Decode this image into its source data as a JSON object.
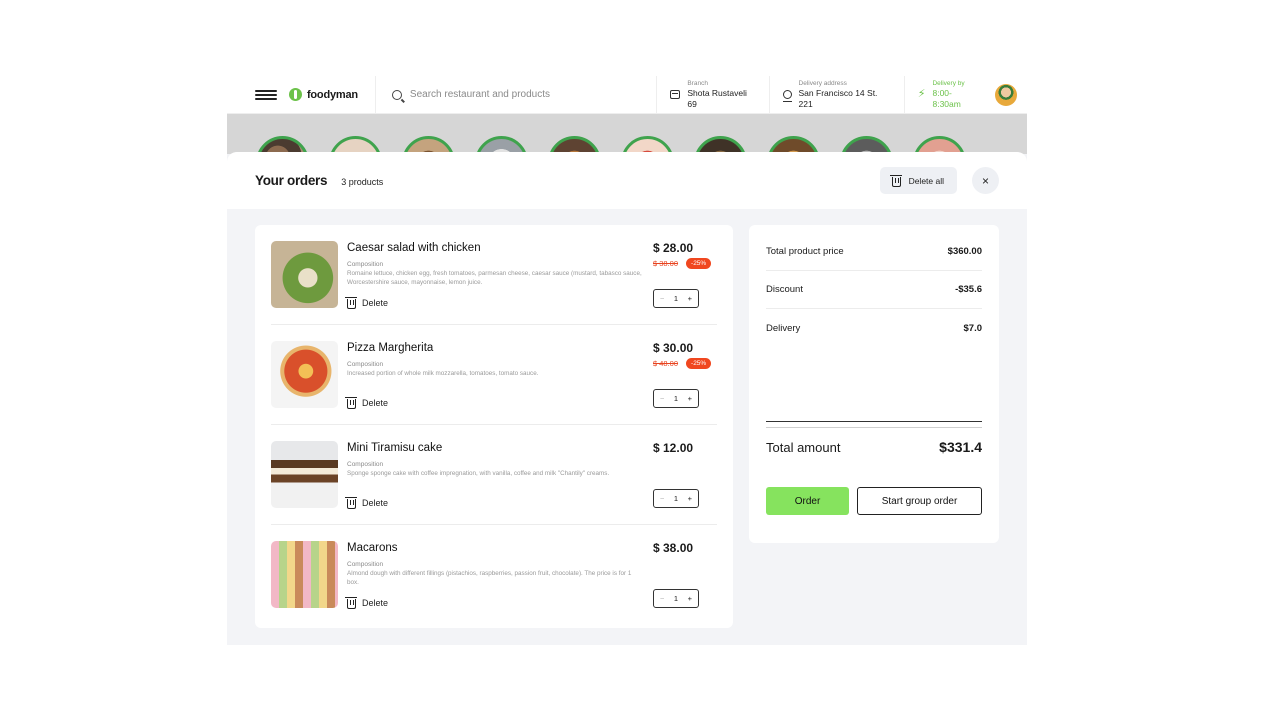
{
  "header": {
    "logo_text": "foodyman",
    "search_placeholder": "Search restaurant and products",
    "branch_label": "Branch",
    "branch_value": "Shota Rustaveli 69",
    "address_label": "Delivery address",
    "address_value": "San Francisco 14 St. 221",
    "delivery_label": "Delivery by",
    "delivery_value": "8:00-8:30am",
    "accent_color": "#6cc24a"
  },
  "categories_count_visible": 10,
  "modal": {
    "title": "Your orders",
    "count": "3 products",
    "delete_all_label": "Delete all",
    "close_icon": "×"
  },
  "cart": {
    "items": [
      {
        "name": "Caesar salad with chicken",
        "composition_label": "Composition",
        "composition": "Romaine lettuce, chicken egg, fresh tomatoes, parmesan cheese, caesar sauce (mustard, tabasco sauce, Worcestershire sauce, mayonnaise, lemon juice.",
        "delete_label": "Delete",
        "price": "$ 28.00",
        "old_price": "$ 38.00",
        "discount": "-25%",
        "qty": "1"
      },
      {
        "name": "Pizza Margherita",
        "composition_label": "Composition",
        "composition": "Increased portion of whole milk mozzarella, tomatoes, tomato sauce.",
        "delete_label": "Delete",
        "price": "$ 30.00",
        "old_price": "$ 48.00",
        "discount": "-25%",
        "qty": "1"
      },
      {
        "name": "Mini Tiramisu cake",
        "composition_label": "Composition",
        "composition": "Sponge sponge cake with coffee impregnation, with vanilla, coffee and milk \"Chantily\" creams.",
        "delete_label": "Delete",
        "price": "$ 12.00",
        "qty": "1"
      },
      {
        "name": "Macarons",
        "composition_label": "Composition",
        "composition": "Almond dough with different fillings (pistachios, raspberries, passion fruit, chocolate). The price is for 1 box.",
        "delete_label": "Delete",
        "price": "$ 38.00",
        "qty": "1"
      }
    ],
    "minus": "−",
    "plus": "+"
  },
  "summary": {
    "total_product_price_label": "Total product price",
    "total_product_price": "$360.00",
    "discount_label": "Discount",
    "discount": "-$35.6",
    "delivery_label": "Delivery",
    "delivery": "$7.0",
    "total_amount_label": "Total amount",
    "total_amount": "$331.4",
    "order_label": "Order",
    "group_order_label": "Start group order",
    "order_color": "#86e35e"
  }
}
